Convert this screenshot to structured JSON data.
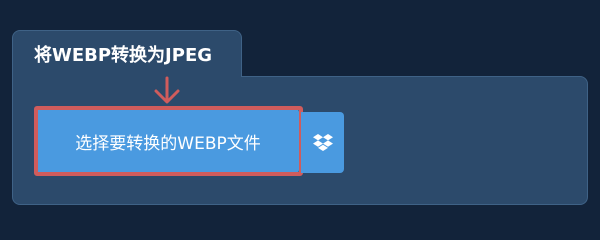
{
  "card": {
    "title": "将WEBP转换为JPEG"
  },
  "upload": {
    "choose_file_label": "选择要转换的WEBP文件",
    "dropbox_icon": "dropbox-icon"
  },
  "annotation": {
    "arrow_icon": "arrow-down-icon",
    "highlight_color": "#d05c5c"
  },
  "colors": {
    "page_background": "#12233a",
    "card_background": "#2c4a6b",
    "button_background": "#4a9ae0",
    "text": "#ffffff"
  }
}
